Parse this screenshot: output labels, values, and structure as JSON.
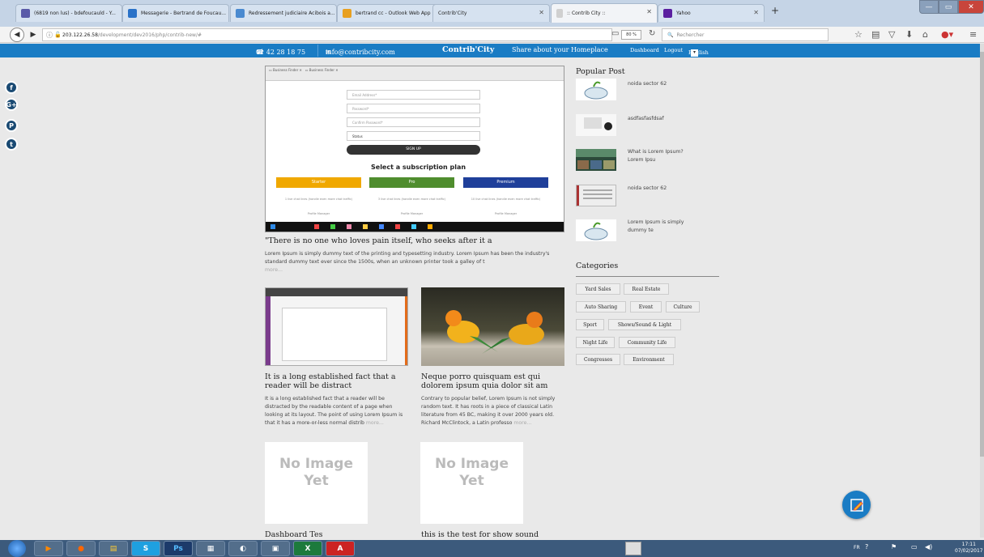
{
  "browser": {
    "tabs": [
      {
        "label": "(6819 non lus) - bdefoucauld - Y...",
        "color": "#5a5aa8"
      },
      {
        "label": "Messagerie - Bertrand de Foucau...",
        "color": "#2a72c8"
      },
      {
        "label": "Redressement judiciaire Acibois a...",
        "color": "#4a8ad0"
      },
      {
        "label": "bertrand cc - Outlook Web App",
        "color": "#e8a020"
      },
      {
        "label": "Contrib'City",
        "color": "#cfd8e3"
      },
      {
        "label": ":: Contrib City ::",
        "color": "#d0d0d0"
      },
      {
        "label": "Yahoo",
        "color": "#5a1fa0"
      }
    ],
    "url_host": "203.122.26.58",
    "url_path": "/development/dev2016/php/contrib-new/#",
    "zoom": "80 %",
    "search_placeholder": "Rechercher"
  },
  "site": {
    "phone": "01 42 28 18 75",
    "email": "info@contribcity.com",
    "brand": "Contrib'City",
    "tagline": "Share about your Homeplace",
    "nav_dashboard": "Dashboard",
    "nav_logout": "Logout",
    "nav_lang": "English"
  },
  "embedded": {
    "email_ph": "Email Address*",
    "password_ph": "Password*",
    "confirm_ph": "Confirm Password*",
    "select_value": "Status",
    "signup": "SIGN UP",
    "plan_title": "Select a subscription plan",
    "plans": [
      "Starter",
      "Pro",
      "Premium"
    ],
    "plan_line1": [
      "1 live chat lines (handle even more chat traffic)",
      "3 live chat lines (handle even more chat traffic)",
      "10 live chat lines (handle even more chat traffic)"
    ],
    "plan_line2": "Profile Manager"
  },
  "posts": {
    "featured_title": "\"There is no one who loves pain itself, who seeks after it a",
    "featured_excerpt": "Lorem Ipsum is simply dummy text of the printing and typesetting industry. Lorem Ipsum has been the industry's standard dummy text ever since the 1500s, when an unknown printer took a galley of t",
    "more": "more...",
    "post1_title": "It is a long established fact that a reader will be distract",
    "post1_excerpt": "It is a long established fact that a reader will be distracted by the readable content of a page when looking at its layout. The point of using Lorem Ipsum is that it has a more-or-less normal distrib",
    "post2_title": "Neque porro quisquam est qui dolorem ipsum quia dolor sit am",
    "post2_excerpt": "Contrary to popular belief, Lorem Ipsum is not simply random text. It has roots in a piece of classical Latin literature from 45 BC, making it over 2000 years old. Richard McClintock, a Latin professo",
    "no_image": "No Image Yet",
    "post3_title": "Dashboard Tes",
    "post4_title": "this is the test for show sound"
  },
  "sidebar": {
    "popular_title": "Popular Post",
    "popular": [
      "noida sector 62",
      "asdfasfasfdsaf",
      "What is Lorem Ipsum?Lorem Ipsu",
      "noida sector 62",
      "Lorem Ipsum is simply dummy te"
    ],
    "categories_title": "Categories",
    "categories": [
      "Yard Sales",
      "Real Estate",
      "Auto Sharing",
      "Event",
      "Culture",
      "Sport",
      "Shows/Sound & Light",
      "Night Life",
      "Community Life",
      "Congresses",
      "Environment"
    ]
  },
  "taskbar": {
    "lang": "FR",
    "time": "17:11",
    "date": "07/02/2017"
  },
  "colors": {
    "brand_blue": "#1a7cc4",
    "starter": "#f0a800",
    "pro": "#4f8d2e",
    "premium": "#1f3f9a"
  }
}
